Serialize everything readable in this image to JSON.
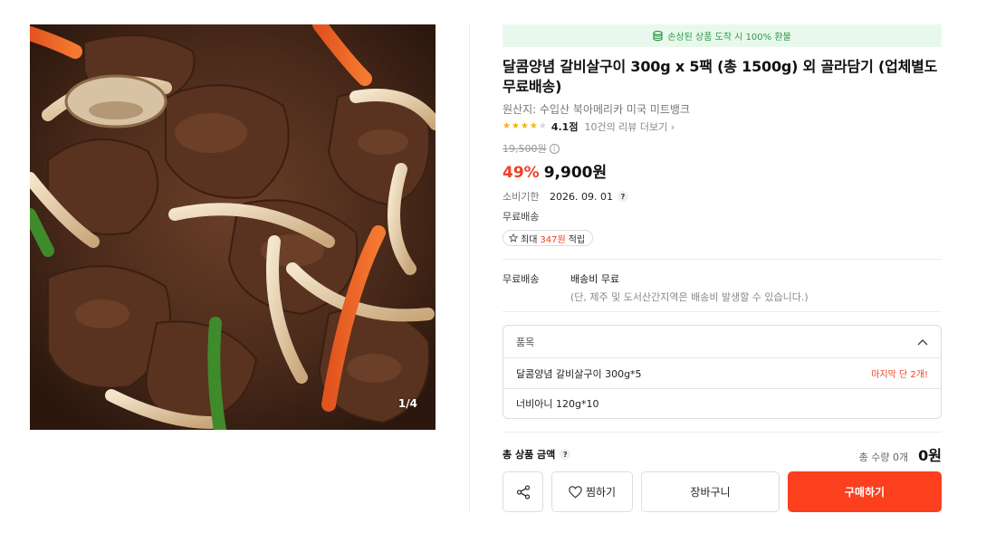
{
  "product_image": {
    "alt": "",
    "counter": "1/4",
    "icon": "photo-image"
  },
  "banner": {
    "text": "손상된 상품 도착 시 100% 환불",
    "icon": "coin-stack-icon",
    "color": "#2f9a4a",
    "background": "#e9f8ec"
  },
  "product": {
    "title": "달콤양념 갈비살구이 300g x 5팩 (총 1500g) 외 골라담기 (업체별도 무료배송)",
    "origin": "원산지: 수입산 북아메리카 미국 미트뱅크",
    "rating": {
      "stars_filled": 4,
      "stars_total": 5,
      "score": "4.1점",
      "reviews_link": "10건의 리뷰 더보기"
    },
    "original_price": "19,500원",
    "discount": "49%",
    "sale_price": "9,900원",
    "expiry_label": "소비기한",
    "expiry_value": "2026. 09. 01",
    "free_shipping": "무료배송",
    "points": {
      "prefix": "최대",
      "amount": "347원",
      "suffix": "적립"
    }
  },
  "shipping": {
    "label": "무료배송",
    "main": "배송비 무료",
    "note": "(단, 제주 및 도서산간지역은 배송비 발생할 수 있습니다.)"
  },
  "options": {
    "header": "품목",
    "items": [
      {
        "name": "달콤양념 갈비살구이 300g*5",
        "badge": "마지막 단 2개!"
      },
      {
        "name": "너비아니 120g*10",
        "badge": ""
      }
    ]
  },
  "total": {
    "label": "총 상품 금액",
    "qty": "총 수량 0개",
    "amount": "0원"
  },
  "actions": {
    "wish_label": "찜하기",
    "cart_label": "장바구니",
    "buy_label": "구매하기"
  },
  "colors": {
    "accent": "#fc3f1d",
    "discount": "#f04125",
    "star": "#f7b500"
  }
}
